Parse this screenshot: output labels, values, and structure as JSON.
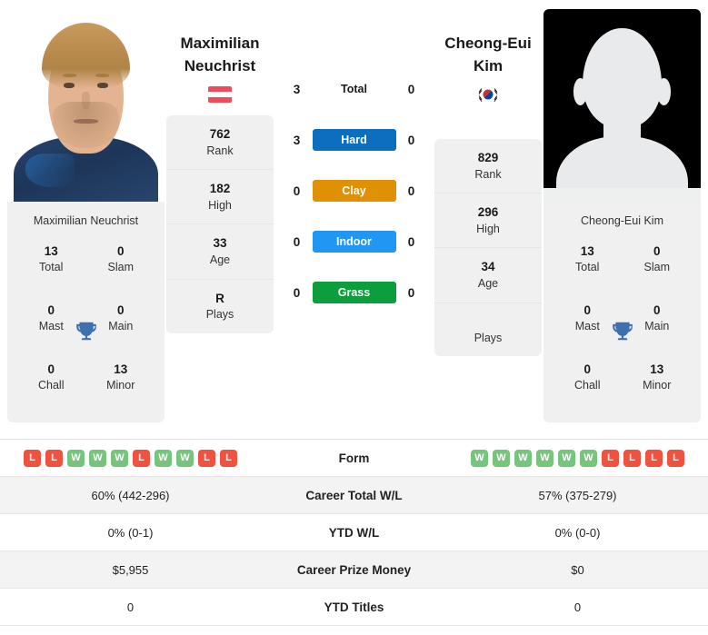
{
  "colors": {
    "hard": "#0d6ec0",
    "clay": "#e09005",
    "indoor": "#2196f3",
    "grass": "#0c9e3c",
    "win": "#77c47c",
    "loss": "#ef5340",
    "card_bg": "#f0f0f0",
    "trophy": "#3e6fb0"
  },
  "left_player": {
    "name_line1": "Maximilian",
    "name_line2": "Neuchrist",
    "full_name": "Maximilian Neuchrist",
    "flag": "austria-flag",
    "photo_alt": "player-photo",
    "attributes": [
      {
        "value": "762",
        "label": "Rank"
      },
      {
        "value": "182",
        "label": "High"
      },
      {
        "value": "33",
        "label": "Age"
      },
      {
        "value": "R",
        "label": "Plays"
      }
    ],
    "titles": [
      {
        "value": "13",
        "label": "Total"
      },
      {
        "value": "0",
        "label": "Slam"
      },
      {
        "value": "0",
        "label": "Mast"
      },
      {
        "value": "0",
        "label": "Main"
      },
      {
        "value": "0",
        "label": "Chall"
      },
      {
        "value": "13",
        "label": "Minor"
      }
    ],
    "surface_wins": {
      "total": "3",
      "hard": "3",
      "clay": "0",
      "indoor": "0",
      "grass": "0"
    },
    "form": [
      "L",
      "L",
      "W",
      "W",
      "W",
      "L",
      "W",
      "W",
      "L",
      "L"
    ],
    "career_total_wl": "60% (442-296)",
    "ytd_wl": "0% (0-1)",
    "career_prize_money": "$5,955",
    "ytd_titles": "0"
  },
  "right_player": {
    "name_line1": "Cheong-Eui",
    "name_line2": "Kim",
    "full_name": "Cheong-Eui Kim",
    "flag": "south-korea-flag",
    "photo_alt": "player-photo-placeholder",
    "attributes": [
      {
        "value": "829",
        "label": "Rank"
      },
      {
        "value": "296",
        "label": "High"
      },
      {
        "value": "34",
        "label": "Age"
      },
      {
        "value": "",
        "label": "Plays"
      }
    ],
    "titles": [
      {
        "value": "13",
        "label": "Total"
      },
      {
        "value": "0",
        "label": "Slam"
      },
      {
        "value": "0",
        "label": "Mast"
      },
      {
        "value": "0",
        "label": "Main"
      },
      {
        "value": "0",
        "label": "Chall"
      },
      {
        "value": "13",
        "label": "Minor"
      }
    ],
    "surface_wins": {
      "total": "0",
      "hard": "0",
      "clay": "0",
      "indoor": "0",
      "grass": "0"
    },
    "form": [
      "W",
      "W",
      "W",
      "W",
      "W",
      "W",
      "L",
      "L",
      "L",
      "L"
    ],
    "career_total_wl": "57% (375-279)",
    "ytd_wl": "0% (0-0)",
    "career_prize_money": "$0",
    "ytd_titles": "0"
  },
  "surfaces": [
    {
      "key": "total",
      "label": "Total",
      "style": "plain"
    },
    {
      "key": "hard",
      "label": "Hard",
      "style": "bar"
    },
    {
      "key": "clay",
      "label": "Clay",
      "style": "bar"
    },
    {
      "key": "indoor",
      "label": "Indoor",
      "style": "bar"
    },
    {
      "key": "grass",
      "label": "Grass",
      "style": "bar"
    }
  ],
  "table": {
    "rows": [
      {
        "label": "Form",
        "left_key": "form",
        "right_key": "form",
        "type": "form"
      },
      {
        "label": "Career Total W/L",
        "left_key": "career_total_wl",
        "right_key": "career_total_wl",
        "type": "text"
      },
      {
        "label": "YTD W/L",
        "left_key": "ytd_wl",
        "right_key": "ytd_wl",
        "type": "text"
      },
      {
        "label": "Career Prize Money",
        "left_key": "career_prize_money",
        "right_key": "career_prize_money",
        "type": "text"
      },
      {
        "label": "YTD Titles",
        "left_key": "ytd_titles",
        "right_key": "ytd_titles",
        "type": "text"
      }
    ]
  }
}
